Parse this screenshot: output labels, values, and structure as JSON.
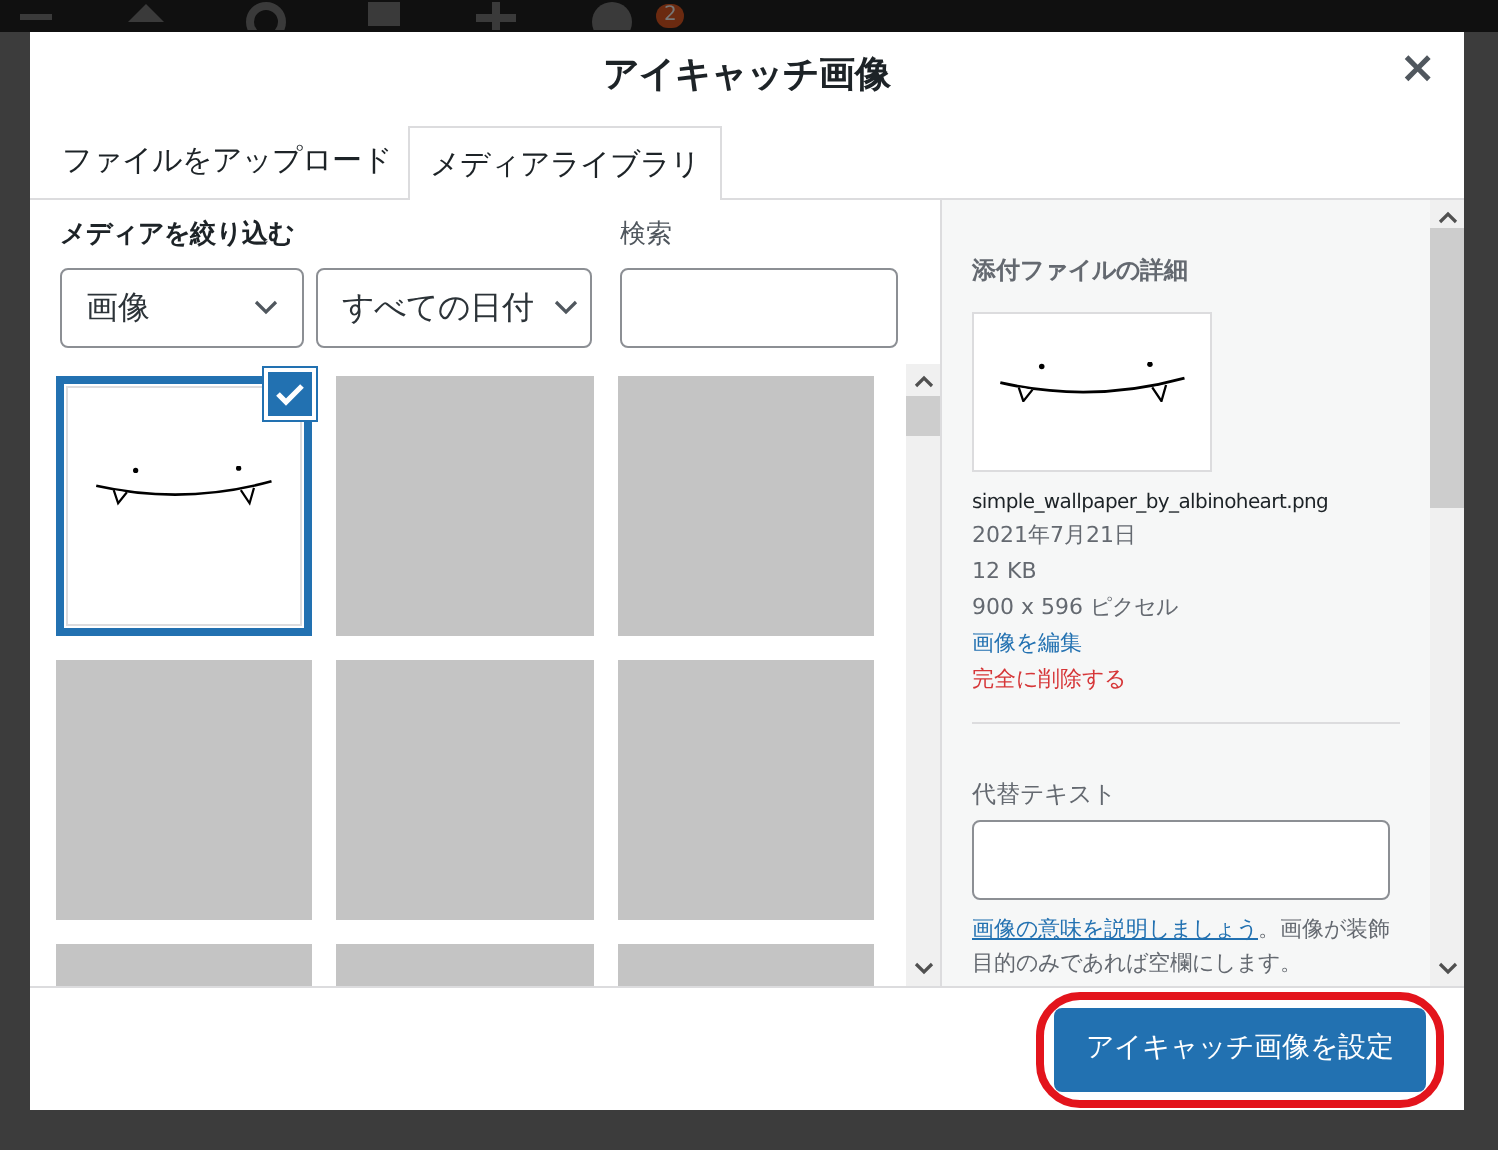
{
  "admin_bar": {
    "badge": "2"
  },
  "modal": {
    "title": "アイキャッチ画像",
    "close": "×",
    "tabs": [
      {
        "label": "ファイルをアップロード",
        "selected": false
      },
      {
        "label": "メディアライブラリ",
        "selected": true
      }
    ],
    "filter": {
      "label": "メディアを絞り込む",
      "type_select": "画像",
      "date_select": "すべての日付"
    },
    "search": {
      "label": "検索"
    },
    "grid": [
      {
        "kind": "image",
        "selected": true
      },
      {
        "kind": "placeholder",
        "selected": false
      },
      {
        "kind": "placeholder",
        "selected": false
      },
      {
        "kind": "placeholder",
        "selected": false
      },
      {
        "kind": "placeholder",
        "selected": false
      },
      {
        "kind": "placeholder",
        "selected": false
      },
      {
        "kind": "placeholder",
        "selected": false
      },
      {
        "kind": "placeholder",
        "selected": false
      },
      {
        "kind": "placeholder",
        "selected": false
      }
    ],
    "details": {
      "heading": "添付ファイルの詳細",
      "filename": "simple_wallpaper_by_albinoheart.png",
      "date": "2021年7月21日",
      "size": "12 KB",
      "dimensions": "900 x 596 ピクセル",
      "edit_link": "画像を編集",
      "delete_link": "完全に削除する",
      "alt_label": "代替テキスト",
      "help_link": "画像の意味を説明しましょう",
      "help_text": "。画像が装飾目的のみであれば空欄にします。"
    },
    "footer": {
      "button": "アイキャッチ画像を設定"
    }
  }
}
